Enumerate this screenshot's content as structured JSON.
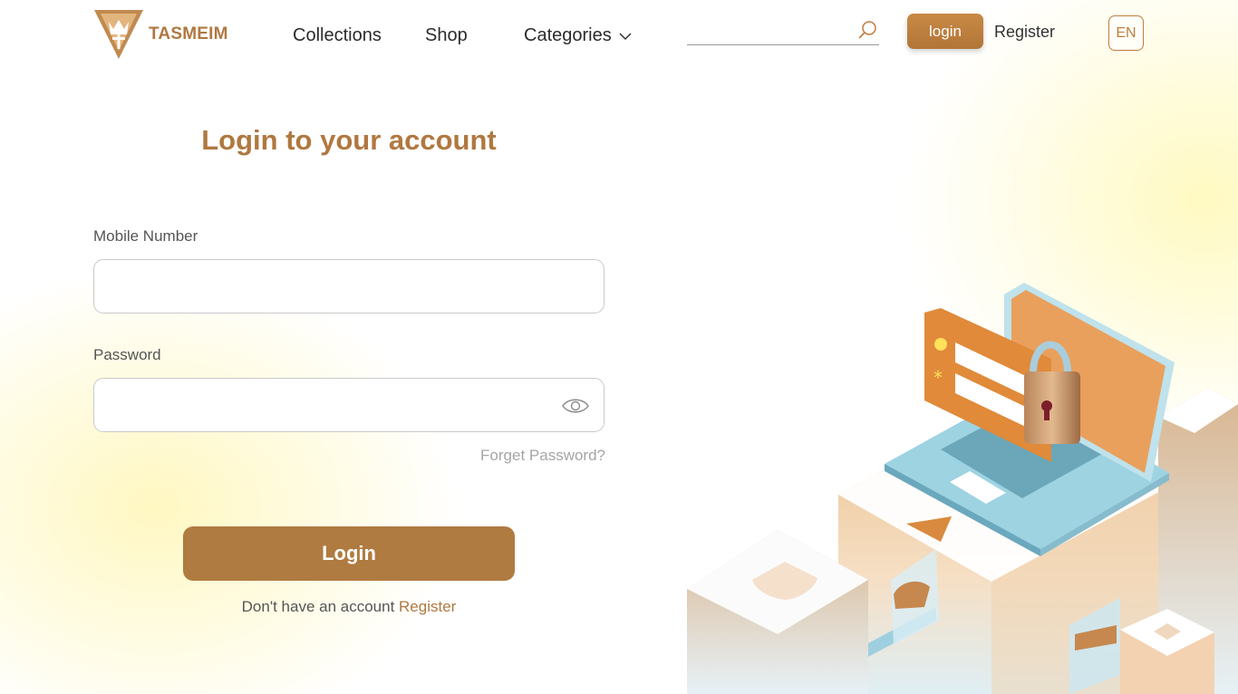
{
  "header": {
    "brand": "TASMEIM",
    "nav": {
      "collections": "Collections",
      "shop": "Shop",
      "categories": "Categories"
    },
    "search": {
      "value": "",
      "placeholder": ""
    },
    "login_button": "login",
    "register_link": "Register",
    "language": "EN"
  },
  "form": {
    "title": "Login to your account",
    "mobile_label": "Mobile Number",
    "mobile_value": "",
    "password_label": "Password",
    "password_value": "",
    "forgot": "Forget Password?",
    "login_button": "Login",
    "signup_prompt": "Don't have an account",
    "signup_link": "Register"
  },
  "icons": {
    "search": "search-icon",
    "chevron": "chevron-down-icon",
    "eye": "eye-icon",
    "logo": "crown-shield-logo"
  },
  "colors": {
    "brand": "#b07840",
    "button": "#b07b41",
    "accent_orange": "#e08a3a"
  }
}
